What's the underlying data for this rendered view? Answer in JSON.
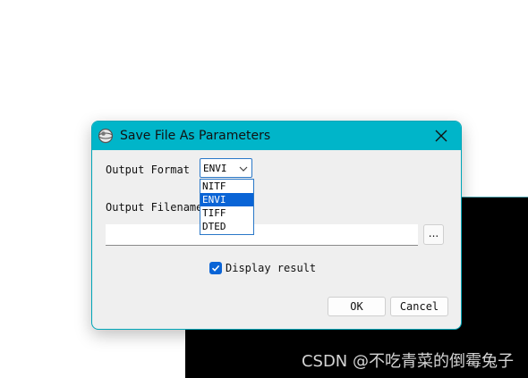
{
  "dialog": {
    "title": "Save File As Parameters",
    "output_format": {
      "label": "Output Format",
      "selected": "ENVI",
      "options": [
        "NITF",
        "ENVI",
        "TIFF",
        "DTED"
      ]
    },
    "output_filename": {
      "label": "Output Filename",
      "value": "",
      "browse_label": "..."
    },
    "display_result": {
      "label": "Display result",
      "checked": true
    },
    "buttons": {
      "ok": "OK",
      "cancel": "Cancel"
    }
  },
  "watermark": "CSDN @不吃青菜的倒霉兔子",
  "colors": {
    "titlebar": "#00b5c9",
    "selection": "#0a64d6",
    "border": "#00a6b8"
  }
}
